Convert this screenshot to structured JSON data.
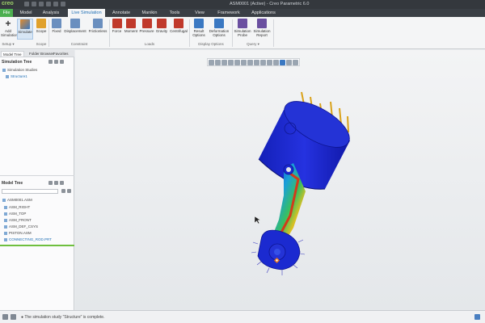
{
  "titlebar": {
    "logo": "creo",
    "window_title": "ASM0001 (Active) - Creo Parametric 6.0"
  },
  "tabs": [
    {
      "label": "File"
    },
    {
      "label": "Model"
    },
    {
      "label": "Analysis"
    },
    {
      "label": "Live Simulation"
    },
    {
      "label": "Annotate"
    },
    {
      "label": "Manikin"
    },
    {
      "label": "Tools"
    },
    {
      "label": "View"
    },
    {
      "label": "Framework"
    },
    {
      "label": "Applications"
    }
  ],
  "ribbon": {
    "buttons": [
      {
        "label": "Add Simulation",
        "icon": "plus-icon",
        "color": "#333333"
      },
      {
        "label": "Simulate",
        "icon": "simulate-icon",
        "color": "#e08a2c"
      },
      {
        "label": "Scope",
        "icon": "scope-icon",
        "color": "#e0a12c"
      },
      {
        "label": "Fixed",
        "icon": "fixed-icon",
        "color": "#6a8fbf"
      },
      {
        "label": "Displacement",
        "icon": "displacement-icon",
        "color": "#6a8fbf"
      },
      {
        "label": "Frictionless",
        "icon": "frictionless-icon",
        "color": "#6a8fbf"
      },
      {
        "label": "Force",
        "icon": "force-icon",
        "color": "#c0392b"
      },
      {
        "label": "Moment",
        "icon": "moment-icon",
        "color": "#c0392b"
      },
      {
        "label": "Pressure",
        "icon": "pressure-icon",
        "color": "#c0392b"
      },
      {
        "label": "Gravity",
        "icon": "gravity-icon",
        "color": "#c0392b"
      },
      {
        "label": "Centrifugal",
        "icon": "centrifugal-icon",
        "color": "#c0392b"
      },
      {
        "label": "Result Options",
        "icon": "result-options-icon",
        "color": "#3a78c2"
      },
      {
        "label": "Deformation Options",
        "icon": "deformation-options-icon",
        "color": "#3a78c2"
      },
      {
        "label": "Simulation Probe",
        "icon": "probe-icon",
        "color": "#6a4fa0"
      },
      {
        "label": "Simulation Report",
        "icon": "report-icon",
        "color": "#6a4fa0"
      }
    ],
    "groups": [
      {
        "label": "Setup ▾"
      },
      {
        "label": "Scope"
      },
      {
        "label": "Constraint"
      },
      {
        "label": "Loads"
      },
      {
        "label": "Display Options"
      },
      {
        "label": "Query ▾"
      }
    ]
  },
  "left_panel": {
    "tabs": [
      {
        "label": "Model Tree"
      },
      {
        "label": "Folder Browser"
      },
      {
        "label": "Favorites"
      }
    ],
    "simulation_tree": {
      "title": "Simulation Tree",
      "items": [
        "Simulation Studies",
        "Structure1"
      ]
    },
    "model_tree": {
      "title": "Model Tree",
      "items": [
        "ASM0001.ASM",
        "ASM_RIGHT",
        "ASM_TOP",
        "ASM_FRONT",
        "ASM_DEF_CSYS",
        "PISTON.ASM",
        "CONNECTING_ROD.PRT"
      ]
    }
  },
  "status": {
    "message": "● The simulation study \"Structure\" is complete."
  },
  "colors": {
    "accent": "#1f6fb5",
    "file_tab": "#4caf50",
    "model_blue": "#1f2bd1"
  }
}
